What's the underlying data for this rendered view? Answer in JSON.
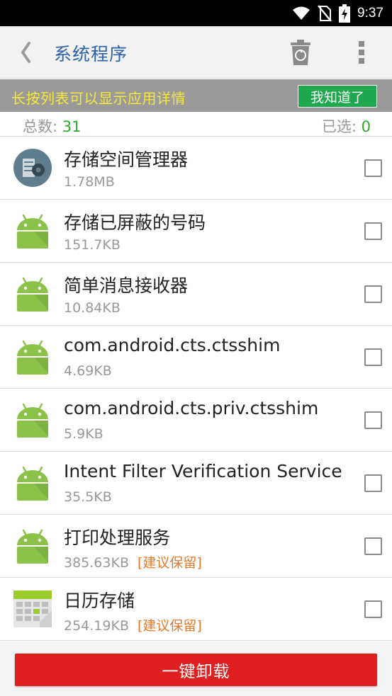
{
  "status_bar": {
    "time": "9:37"
  },
  "appbar": {
    "title": "系统程序"
  },
  "tip": {
    "text": "长按列表可以显示应用详情",
    "ok_label": "我知道了"
  },
  "counts": {
    "total_label": "总数: ",
    "total_value": "31",
    "selected_label": "已选: ",
    "selected_value": "0"
  },
  "apps": [
    {
      "name": "存储空间管理器",
      "size": "1.78MB",
      "badge": "",
      "icon": "storage-manager-icon"
    },
    {
      "name": "存储已屏蔽的号码",
      "size": "151.7KB",
      "badge": "",
      "icon": "android-icon"
    },
    {
      "name": "简单消息接收器",
      "size": "10.84KB",
      "badge": "",
      "icon": "android-icon"
    },
    {
      "name": "com.android.cts.ctsshim",
      "size": "4.69KB",
      "badge": "",
      "icon": "android-icon"
    },
    {
      "name": "com.android.cts.priv.ctsshim",
      "size": "5.9KB",
      "badge": "",
      "icon": "android-icon"
    },
    {
      "name": "Intent Filter Verification Service",
      "size": "35.5KB",
      "badge": "",
      "icon": "android-icon"
    },
    {
      "name": "打印处理服务",
      "size": "385.63KB",
      "badge": "[建议保留]",
      "icon": "android-icon"
    },
    {
      "name": "日历存储",
      "size": "254.19KB",
      "badge": "[建议保留]",
      "icon": "calendar-storage-icon"
    }
  ],
  "bottom": {
    "uninstall_label": "一键卸载"
  },
  "colors": {
    "title_blue": "#2c63a8",
    "tip_yellow": "#f5e83a",
    "ok_green": "#1fa84e",
    "count_green": "#2ea82e",
    "badge_orange": "#e8782a",
    "uninstall_red": "#de2020",
    "android_green": "#8bc34a"
  }
}
